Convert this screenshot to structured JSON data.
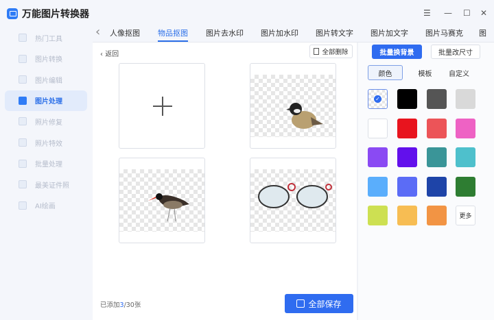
{
  "app": {
    "title": "万能图片转换器"
  },
  "sidebar": {
    "items": [
      {
        "label": "热门工具",
        "active": false
      },
      {
        "label": "图片转换",
        "active": false
      },
      {
        "label": "图片编辑",
        "active": false
      },
      {
        "label": "图片处理",
        "active": true
      },
      {
        "label": "照片修复",
        "active": false
      },
      {
        "label": "照片特效",
        "active": false
      },
      {
        "label": "批量处理",
        "active": false
      },
      {
        "label": "最美证件照",
        "active": false
      },
      {
        "label": "AI绘画",
        "active": false
      }
    ]
  },
  "window": {
    "menu": "☰",
    "minimize": "—",
    "maximize": "☐",
    "close": "✕"
  },
  "tabs": {
    "prev": "‹",
    "items": [
      "人像抠图",
      "物品抠图",
      "图片去水印",
      "图片加水印",
      "图片转文字",
      "图片加文字",
      "图片马赛克",
      "图"
    ],
    "active": 1
  },
  "toolbar": {
    "back": "返回",
    "delete_all": "全部删除"
  },
  "footer": {
    "added_prefix": "已添加",
    "added_count": "3",
    "added_suffix": "/30张",
    "save_all": "全部保存"
  },
  "right": {
    "batch_bg": "批量换背景",
    "batch_resize": "批量改尺寸",
    "segments": [
      "颜色",
      "模板",
      "自定义"
    ],
    "active_segment": 0,
    "swatches": [
      "transparent",
      "#000000",
      "#555555",
      "#d9d9d9",
      "#ffffff",
      "#e8141e",
      "#ec5458",
      "#ee62c4",
      "#8a4af3",
      "#6210ec",
      "#3a9598",
      "#4ec0cc",
      "#5aaefc",
      "#5b6cf6",
      "#1e44a8",
      "#2e7d32",
      "#cde052",
      "#f7bd53",
      "#f29444"
    ],
    "more": "更多",
    "selected": 0
  },
  "colors": {
    "accent": "#2f6cf0"
  }
}
